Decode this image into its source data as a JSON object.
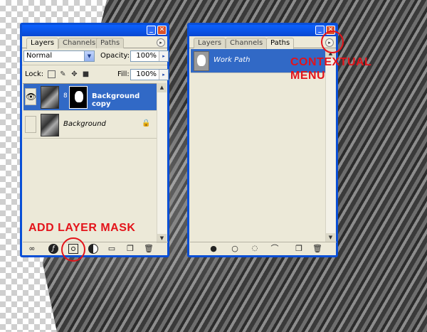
{
  "layers_panel": {
    "tabs": [
      "Layers",
      "Channels",
      "Paths"
    ],
    "active_tab": "Layers",
    "blend_mode": "Normal",
    "opacity_label": "Opacity:",
    "opacity_value": "100%",
    "lock_label": "Lock:",
    "fill_label": "Fill:",
    "fill_value": "100%",
    "layers": [
      {
        "name": "Background copy",
        "selected": true,
        "has_mask": true,
        "visible": true
      },
      {
        "name": "Background",
        "selected": false,
        "has_mask": false,
        "visible": false,
        "locked": true
      }
    ],
    "bottom_icons": [
      "link-icon",
      "layer-style-icon",
      "add-layer-mask-icon",
      "adjustment-layer-icon",
      "new-group-icon",
      "new-layer-icon",
      "trash-icon"
    ]
  },
  "paths_panel": {
    "tabs": [
      "Layers",
      "Channels",
      "Paths"
    ],
    "active_tab": "Paths",
    "paths": [
      {
        "name": "Work Path",
        "selected": true
      }
    ],
    "bottom_icons": [
      "fill-path-icon",
      "stroke-path-icon",
      "load-selection-icon",
      "make-work-path-icon",
      "new-path-icon",
      "delete-path-icon"
    ]
  },
  "annotations": {
    "contextual_menu_line1": "CONTEXTUAL",
    "contextual_menu_line2": "MENU",
    "add_layer_mask": "ADD LAYER MASK",
    "accent_color": "#e3131a"
  },
  "window_controls": {
    "minimize_glyph": "_",
    "close_glyph": "✕"
  },
  "glyphs": {
    "menu_arrow": "▸",
    "dropdown_arrow": "▼",
    "eye": "👁",
    "chain": "8",
    "lock": "🔒"
  }
}
